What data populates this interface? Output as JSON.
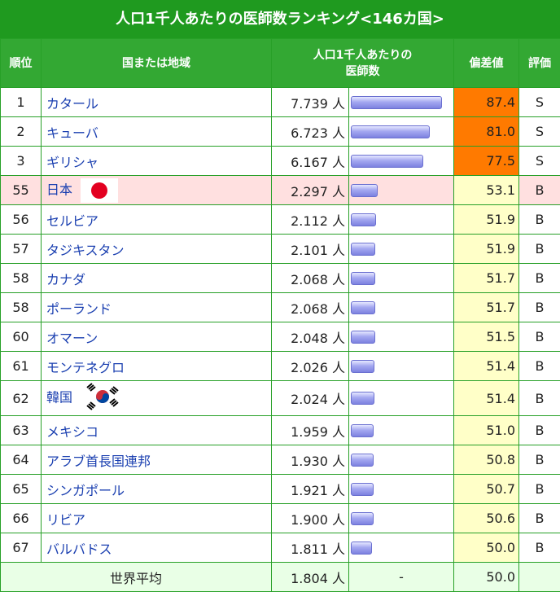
{
  "title": "人口1千人あたりの医師数ランキング<146カ国>",
  "headers": {
    "rank": "順位",
    "country": "国または地域",
    "value_line1": "人口1千人あたりの",
    "value_line2": "医師数",
    "deviation": "偏差値",
    "evaluation": "評価"
  },
  "unit": "人",
  "rows": [
    {
      "rank": "1",
      "country": "カタール",
      "value": "7.739",
      "deviation": "87.4",
      "eval": "S"
    },
    {
      "rank": "2",
      "country": "キューバ",
      "value": "6.723",
      "deviation": "81.0",
      "eval": "S"
    },
    {
      "rank": "3",
      "country": "ギリシャ",
      "value": "6.167",
      "deviation": "77.5",
      "eval": "S"
    },
    {
      "rank": "55",
      "country": "日本",
      "value": "2.297",
      "deviation": "53.1",
      "eval": "B"
    },
    {
      "rank": "56",
      "country": "セルビア",
      "value": "2.112",
      "deviation": "51.9",
      "eval": "B"
    },
    {
      "rank": "57",
      "country": "タジキスタン",
      "value": "2.101",
      "deviation": "51.9",
      "eval": "B"
    },
    {
      "rank": "58",
      "country": "カナダ",
      "value": "2.068",
      "deviation": "51.7",
      "eval": "B"
    },
    {
      "rank": "58",
      "country": "ポーランド",
      "value": "2.068",
      "deviation": "51.7",
      "eval": "B"
    },
    {
      "rank": "60",
      "country": "オマーン",
      "value": "2.048",
      "deviation": "51.5",
      "eval": "B"
    },
    {
      "rank": "61",
      "country": "モンテネグロ",
      "value": "2.026",
      "deviation": "51.4",
      "eval": "B"
    },
    {
      "rank": "62",
      "country": "韓国",
      "value": "2.024",
      "deviation": "51.4",
      "eval": "B"
    },
    {
      "rank": "63",
      "country": "メキシコ",
      "value": "1.959",
      "deviation": "51.0",
      "eval": "B"
    },
    {
      "rank": "64",
      "country": "アラブ首長国連邦",
      "value": "1.930",
      "deviation": "50.8",
      "eval": "B"
    },
    {
      "rank": "65",
      "country": "シンガポール",
      "value": "1.921",
      "deviation": "50.7",
      "eval": "B"
    },
    {
      "rank": "66",
      "country": "リビア",
      "value": "1.900",
      "deviation": "50.6",
      "eval": "B"
    },
    {
      "rank": "67",
      "country": "バルバドス",
      "value": "1.811",
      "deviation": "50.0",
      "eval": "B"
    }
  ],
  "average": {
    "label": "世界平均",
    "value": "1.804",
    "bar": "-",
    "deviation": "50.0"
  },
  "colors": {
    "header_green": "#33a833",
    "title_green": "#1f9a1f",
    "top_deviation_orange": "#ff7a00",
    "deviation_yellow": "#ffffc8",
    "japan_row_pink": "#ffe0e0",
    "average_row_green": "#e9ffe6",
    "link_blue": "#1a3fb0"
  }
}
